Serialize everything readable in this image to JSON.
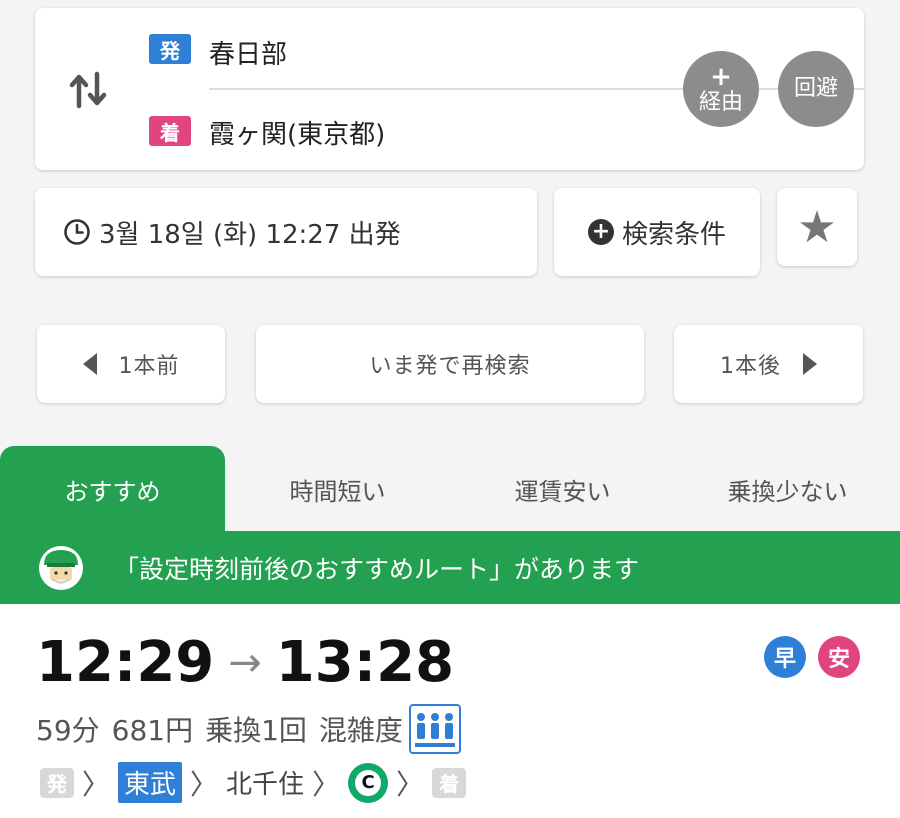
{
  "search": {
    "from_badge": "発",
    "from_station": "春日部",
    "to_badge": "着",
    "to_station": "霞ヶ関(東京都)",
    "via_label": "経由",
    "avoid_label": "回避"
  },
  "datetime": {
    "label": "3월 18일 (화) 12:27 出発"
  },
  "conditions": {
    "label": "検索条件"
  },
  "nav": {
    "prev_label": "1本前",
    "now_label": "いま発で再検索",
    "next_label": "1本後"
  },
  "tabs": [
    {
      "label": "おすすめ",
      "active": true
    },
    {
      "label": "時間短い",
      "active": false
    },
    {
      "label": "運賃安い",
      "active": false
    },
    {
      "label": "乗換少ない",
      "active": false
    }
  ],
  "banner": {
    "text": "「設定時刻前後のおすすめルート」があります"
  },
  "result": {
    "depart": "12:29",
    "arrive": "13:28",
    "flags": [
      "早",
      "安"
    ],
    "duration": "59分",
    "fare": "681円",
    "transfers": "乗換1回",
    "crowd_label": "混雑度",
    "route": {
      "start_tag": "発",
      "line1": "東武",
      "station1": "北千住",
      "line2_symbol": "C",
      "end_tag": "着"
    }
  },
  "colors": {
    "accent_green": "#23a050",
    "blue": "#2f7fd6",
    "pink": "#e0457f",
    "chiyoda_green": "#12a868"
  }
}
